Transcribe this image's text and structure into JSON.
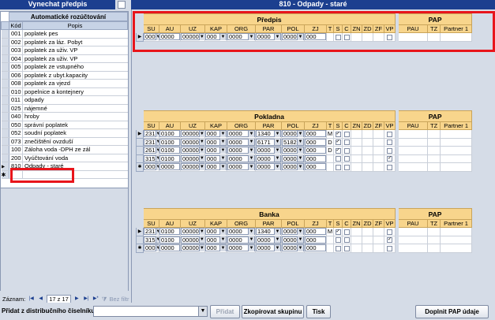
{
  "left": {
    "title": "Vynechat předpis",
    "section_header": "Automatické rozúčtování",
    "col_code": "Kód",
    "col_desc": "Popis",
    "items": [
      {
        "code": "001",
        "desc": "poplatek pes"
      },
      {
        "code": "002",
        "desc": "poplatek za láz. Pobyt"
      },
      {
        "code": "003",
        "desc": "poplatek za uživ. VP"
      },
      {
        "code": "004",
        "desc": "poplatek za uživ. VP"
      },
      {
        "code": "005",
        "desc": "poplatek ze vstupného"
      },
      {
        "code": "006",
        "desc": "poplatek z ubyt.kapacity"
      },
      {
        "code": "008",
        "desc": "poplatek za vjezd"
      },
      {
        "code": "010",
        "desc": "popelnice a kontejnery"
      },
      {
        "code": "011",
        "desc": "odpady"
      },
      {
        "code": "025",
        "desc": "nájemné"
      },
      {
        "code": "040",
        "desc": "hroby"
      },
      {
        "code": "050",
        "desc": "správní poplatek"
      },
      {
        "code": "052",
        "desc": "soudní poplatek"
      },
      {
        "code": "073",
        "desc": "znečištění ovzduší"
      },
      {
        "code": "100",
        "desc": "Záloha voda -DPH ze zál"
      },
      {
        "code": "200",
        "desc": "Vyúčtování voda"
      },
      {
        "code": "810",
        "desc": "Odpady - staré"
      }
    ],
    "nav": {
      "label": "Záznam:",
      "position": "17 z 17",
      "filter": "Bez filtr"
    }
  },
  "main": {
    "title": "810 - Odpady - staré",
    "columns": [
      "SU",
      "AU",
      "UZ",
      "KAP",
      "ORG",
      "PAR",
      "POL",
      "ZJ",
      "T",
      "S",
      "C",
      "ZN",
      "ZD",
      "ZF",
      "VP"
    ],
    "pap_columns": [
      "PAU",
      "TZ",
      "Partner 1"
    ],
    "pap_label": "PAP",
    "predpis": {
      "label": "Předpis",
      "rows": [
        {
          "su": "000",
          "au": "0000",
          "uz": "00000",
          "kap": "000",
          "org": "0000",
          "par": "0000",
          "pol": "0000",
          "zj": "000",
          "t": "",
          "s": false,
          "c": false,
          "vp": false
        }
      ]
    },
    "pokladna": {
      "label": "Pokladna",
      "rows": [
        {
          "su": "231",
          "au": "0100",
          "uz": "00000",
          "kap": "000",
          "org": "0000",
          "par": "1340",
          "pol": "0000",
          "zj": "000",
          "t": "M",
          "s": true,
          "c": false,
          "vp": false
        },
        {
          "su": "231",
          "au": "0100",
          "uz": "00000",
          "kap": "000",
          "org": "0000",
          "par": "6171",
          "pol": "5182",
          "zj": "000",
          "t": "D",
          "s": true,
          "c": false,
          "vp": false
        },
        {
          "su": "261",
          "au": "0100",
          "uz": "00000",
          "kap": "000",
          "org": "0000",
          "par": "0000",
          "pol": "0000",
          "zj": "000",
          "t": "D",
          "s": true,
          "c": false,
          "vp": false
        },
        {
          "su": "315",
          "au": "0100",
          "uz": "00000",
          "kap": "000",
          "org": "0000",
          "par": "0000",
          "pol": "0000",
          "zj": "000",
          "t": "",
          "s": false,
          "c": false,
          "vp": true
        },
        {
          "su": "000",
          "au": "0000",
          "uz": "00000",
          "kap": "000",
          "org": "0000",
          "par": "0000",
          "pol": "0000",
          "zj": "000",
          "t": "",
          "s": false,
          "c": false,
          "vp": false
        }
      ]
    },
    "banka": {
      "label": "Banka",
      "rows": [
        {
          "su": "231",
          "au": "0100",
          "uz": "00000",
          "kap": "000",
          "org": "0000",
          "par": "1340",
          "pol": "0000",
          "zj": "000",
          "t": "M",
          "s": true,
          "c": false,
          "vp": false
        },
        {
          "su": "315",
          "au": "0100",
          "uz": "00000",
          "kap": "000",
          "org": "0000",
          "par": "0000",
          "pol": "0000",
          "zj": "000",
          "t": "",
          "s": false,
          "c": false,
          "vp": true
        },
        {
          "su": "000",
          "au": "0000",
          "uz": "00000",
          "kap": "000",
          "org": "0000",
          "par": "0000",
          "pol": "0000",
          "zj": "000",
          "t": "",
          "s": false,
          "c": false,
          "vp": false
        }
      ]
    }
  },
  "footer": {
    "add_label": "Přidat z distribučního číselníku",
    "add_button": "Přidat",
    "copy_button": "Zkopírovat skupinu",
    "print_button": "Tisk",
    "fill_button": "Doplnit PAP údaje"
  },
  "colors": {
    "highlight": "#e8151b",
    "titlebar": "#1c3f8f",
    "grid_header": "#f8d58c"
  }
}
